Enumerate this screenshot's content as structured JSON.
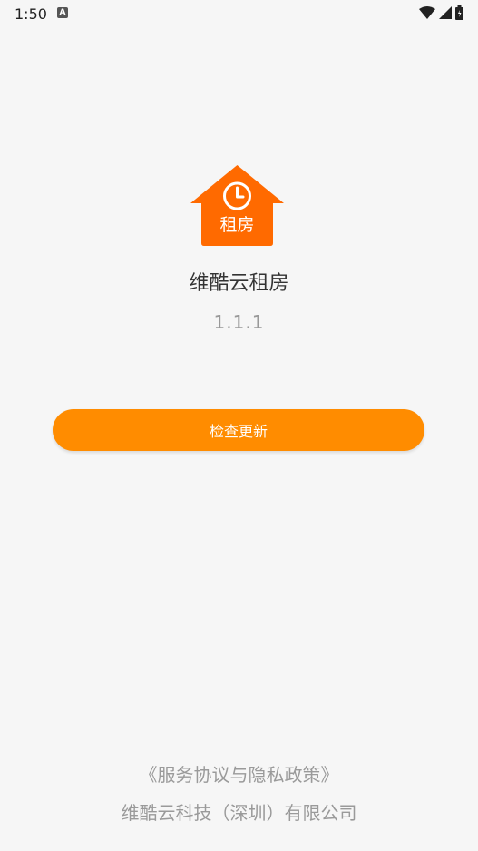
{
  "status_bar": {
    "time": "1:50",
    "notification_icon_letter": "A",
    "icons": [
      "wifi-icon",
      "signal-icon",
      "battery-icon"
    ]
  },
  "app": {
    "logo_text": "租房",
    "name": "维酷云租房",
    "version": "1.1.1"
  },
  "update_button": {
    "label": "检查更新"
  },
  "footer": {
    "agreement": "《服务协议与隐私政策》",
    "company": "维酷云科技（深圳）有限公司"
  },
  "colors": {
    "accent": "#ff8c00",
    "logo_orange": "#ff6a00",
    "background": "#f6f6f6"
  }
}
